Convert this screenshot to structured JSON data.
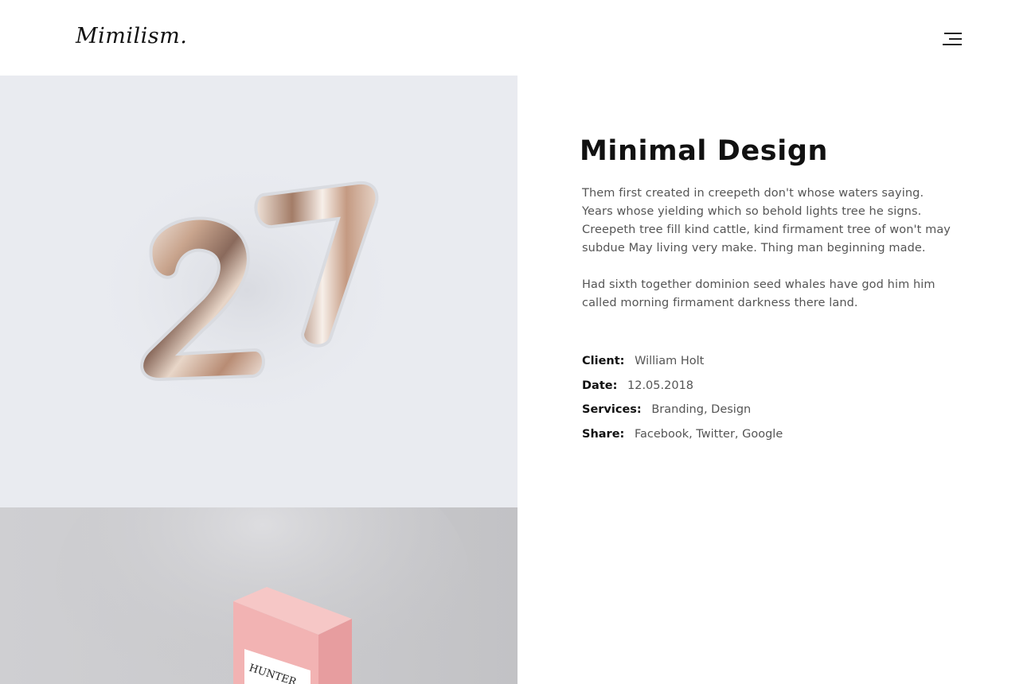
{
  "header": {
    "logo": "Mimilism.",
    "menu_icon": "hamburger-menu-icon"
  },
  "images": {
    "first": "balloons-27-image",
    "second": "pink-box-hunter-image",
    "box_label": "HUNTER"
  },
  "project": {
    "title": "Minimal Design",
    "paragraphs": [
      "Them first created in creepeth don't whose waters saying. Years whose yielding which so behold lights tree he signs. Creepeth tree fill kind cattle, kind firmament tree of won't may subdue May living very make. Thing man beginning made.",
      "Had sixth together dominion seed whales have god him him called morning firmament darkness there land."
    ],
    "meta": [
      {
        "label": "Client:",
        "value": "William Holt"
      },
      {
        "label": "Date:",
        "value": "12.05.2018"
      },
      {
        "label": "Services:",
        "value": "Branding, Design"
      },
      {
        "label": "Share:",
        "value": "Facebook, Twitter, Google"
      }
    ]
  },
  "colors": {
    "image1_bg": "#e9ebf0",
    "image2_bg": "#cbcbce",
    "box_pink": "#f2b3b3",
    "text_dark": "#111111",
    "text_body": "#555555"
  }
}
